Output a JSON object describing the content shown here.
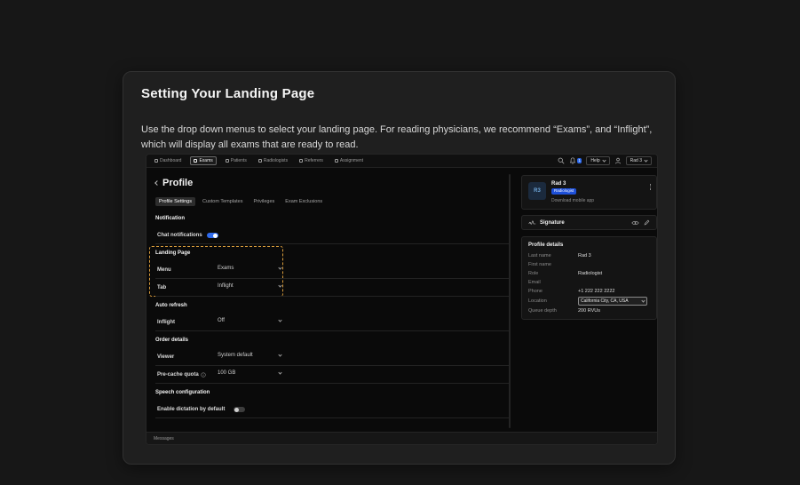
{
  "doc": {
    "title": "Setting Your Landing Page",
    "description_line1": "Use the drop down menus to select your landing page. For reading physicians, we recommend “Exams”, and “Inflight”,",
    "description_line2": "which will display all exams that are ready to read."
  },
  "app": {
    "nav": {
      "tabs": [
        {
          "label": "Dashboard",
          "active": false
        },
        {
          "label": "Exams",
          "active": true
        },
        {
          "label": "Patients",
          "active": false
        },
        {
          "label": "Radiologists",
          "active": false
        },
        {
          "label": "Referrers",
          "active": false
        },
        {
          "label": "Assignment",
          "active": false
        }
      ],
      "notification_count": "1",
      "help_label": "Help",
      "user_label": "Rad 3"
    },
    "profile": {
      "page_title": "Profile",
      "tabs": [
        {
          "label": "Profile Settings",
          "active": true
        },
        {
          "label": "Custom Templates",
          "active": false
        },
        {
          "label": "Privileges",
          "active": false
        },
        {
          "label": "Exam Exclusions",
          "active": false
        }
      ],
      "notification_section": {
        "title": "Notification",
        "chat_label": "Chat notifications",
        "chat_on": true
      },
      "landing_section": {
        "title": "Landing Page",
        "menu_label": "Menu",
        "menu_value": "Exams",
        "tab_label": "Tab",
        "tab_value": "Inflight"
      },
      "auto_refresh_section": {
        "title": "Auto refresh",
        "inflight_label": "Inflight",
        "inflight_value": "Off"
      },
      "order_section": {
        "title": "Order details",
        "viewer_label": "Viewer",
        "viewer_value": "System default",
        "precache_label": "Pre-cache quota",
        "precache_value": "100 GB"
      },
      "speech_section": {
        "title": "Speech configuration",
        "dictation_label": "Enable dictation by default",
        "dictation_on": false
      },
      "footer_label": "Messages"
    },
    "panel": {
      "avatar": "R3",
      "name": "Rad 3",
      "role_badge": "Radiologist",
      "download_link": "Download mobile app",
      "signature_label": "Signature",
      "details_title": "Profile details",
      "details": [
        {
          "label": "Last name",
          "value": "Rad 3"
        },
        {
          "label": "First name",
          "value": ""
        },
        {
          "label": "Role",
          "value": "Radiologist"
        },
        {
          "label": "Email",
          "value": ""
        },
        {
          "label": "Phone",
          "value": "+1 222 222 2222"
        },
        {
          "label": "Location",
          "value": "California City, CA, USA"
        },
        {
          "label": "Queue depth",
          "value": "200 RVUs"
        }
      ]
    }
  },
  "colors": {
    "accent_blue": "#2f6bed",
    "badge_blue": "#1d4fd8",
    "highlight_orange": "#d79a3a",
    "card_background": "#1f1f1f",
    "app_background": "#0a0a0a"
  },
  "icons": {
    "search-icon": "magnifier",
    "bell-icon": "bell",
    "user-icon": "person silhouette",
    "kebab-icon": "vertical three dots",
    "eye-icon": "eye / preview",
    "edit-icon": "pencil",
    "info-icon": "info circle",
    "back-icon": "chevron left",
    "chevron-down-icon": "chevron down",
    "signature-icon": "signature squiggle"
  }
}
